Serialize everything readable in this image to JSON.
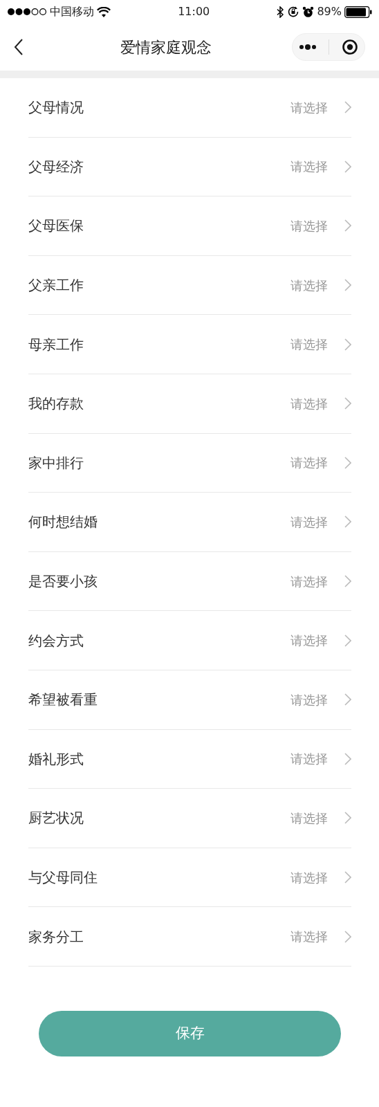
{
  "status_bar": {
    "carrier": "中国移动",
    "time": "11:00",
    "battery": "89%"
  },
  "nav": {
    "title": "爱情家庭观念"
  },
  "fields": [
    {
      "label": "父母情况",
      "value": "请选择"
    },
    {
      "label": "父母经济",
      "value": "请选择"
    },
    {
      "label": "父母医保",
      "value": "请选择"
    },
    {
      "label": "父亲工作",
      "value": "请选择"
    },
    {
      "label": "母亲工作",
      "value": "请选择"
    },
    {
      "label": "我的存款",
      "value": "请选择"
    },
    {
      "label": "家中排行",
      "value": "请选择"
    },
    {
      "label": "何时想结婚",
      "value": "请选择"
    },
    {
      "label": "是否要小孩",
      "value": "请选择"
    },
    {
      "label": "约会方式",
      "value": "请选择"
    },
    {
      "label": "希望被看重",
      "value": "请选择"
    },
    {
      "label": "婚礼形式",
      "value": "请选择"
    },
    {
      "label": "厨艺状况",
      "value": "请选择"
    },
    {
      "label": "与父母同住",
      "value": "请选择"
    },
    {
      "label": "家务分工",
      "value": "请选择"
    }
  ],
  "save_button": "保存"
}
